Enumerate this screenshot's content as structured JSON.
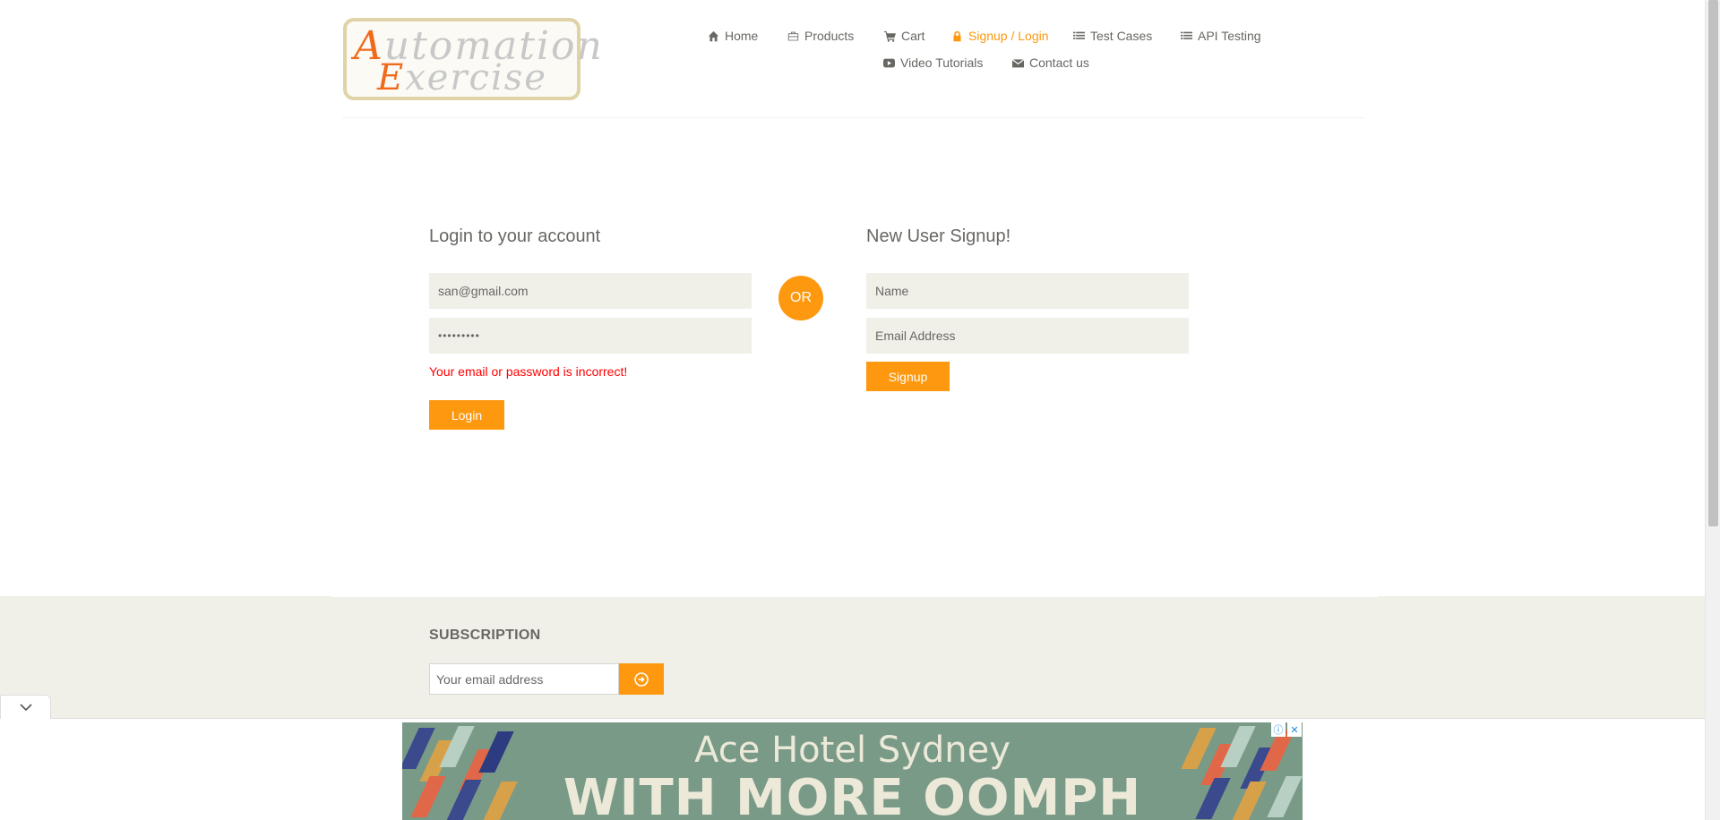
{
  "logo": {
    "line1_cap": "A",
    "line1_rest": "utomation",
    "line2_cap": "E",
    "line2_rest": "xercise"
  },
  "nav": {
    "home": "Home",
    "products": "Products",
    "cart": "Cart",
    "signup_login": "Signup / Login",
    "test_cases": "Test Cases",
    "api_testing": "API Testing",
    "video_tutorials": "Video Tutorials",
    "contact_us": "Contact us"
  },
  "login": {
    "title": "Login to your account",
    "email_value": "san@gmail.com",
    "password_value": "•••••••••",
    "error": "Your email or password is incorrect!",
    "button": "Login"
  },
  "or_label": "OR",
  "signup": {
    "title": "New User Signup!",
    "name_placeholder": "Name",
    "email_placeholder": "Email Address",
    "button": "Signup"
  },
  "subscription": {
    "title": "SUBSCRIPTION",
    "placeholder": "Your email address"
  },
  "ad": {
    "headline1": "Ace Hotel Sydney",
    "headline2": "WITH MORE OOMPH",
    "info_icon": "ⓘ",
    "close_icon": "✕"
  },
  "colors": {
    "accent": "#fe980f",
    "error": "#ff0000",
    "field_bg": "#f0f0e9",
    "text": "#696763"
  }
}
